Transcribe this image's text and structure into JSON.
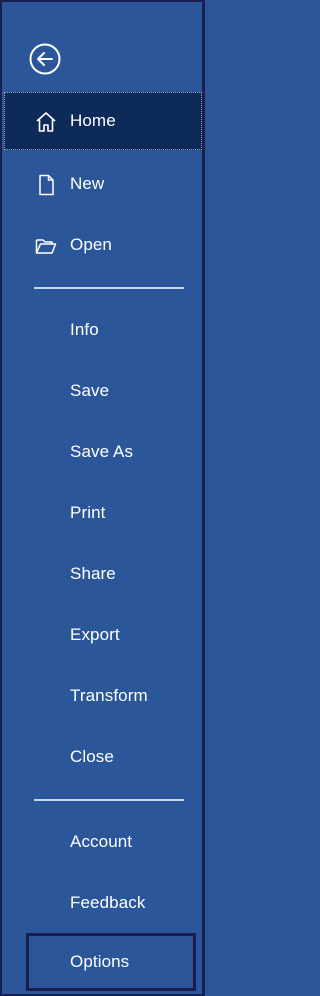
{
  "nav": {
    "back_icon": "back-arrow-icon",
    "primary": [
      {
        "label": "Home",
        "icon": "home-icon",
        "active": true
      },
      {
        "label": "New",
        "icon": "new-document-icon"
      },
      {
        "label": "Open",
        "icon": "open-folder-icon"
      }
    ],
    "secondary": [
      {
        "label": "Info"
      },
      {
        "label": "Save"
      },
      {
        "label": "Save As"
      },
      {
        "label": "Print"
      },
      {
        "label": "Share"
      },
      {
        "label": "Export"
      },
      {
        "label": "Transform"
      },
      {
        "label": "Close"
      }
    ],
    "footer": [
      {
        "label": "Account"
      },
      {
        "label": "Feedback"
      },
      {
        "label": "Options",
        "highlighted": true
      }
    ]
  },
  "colors": {
    "background": "#2b579a",
    "active_item": "#0e2a59",
    "text": "#ffffff",
    "border": "#1a1f4d"
  }
}
